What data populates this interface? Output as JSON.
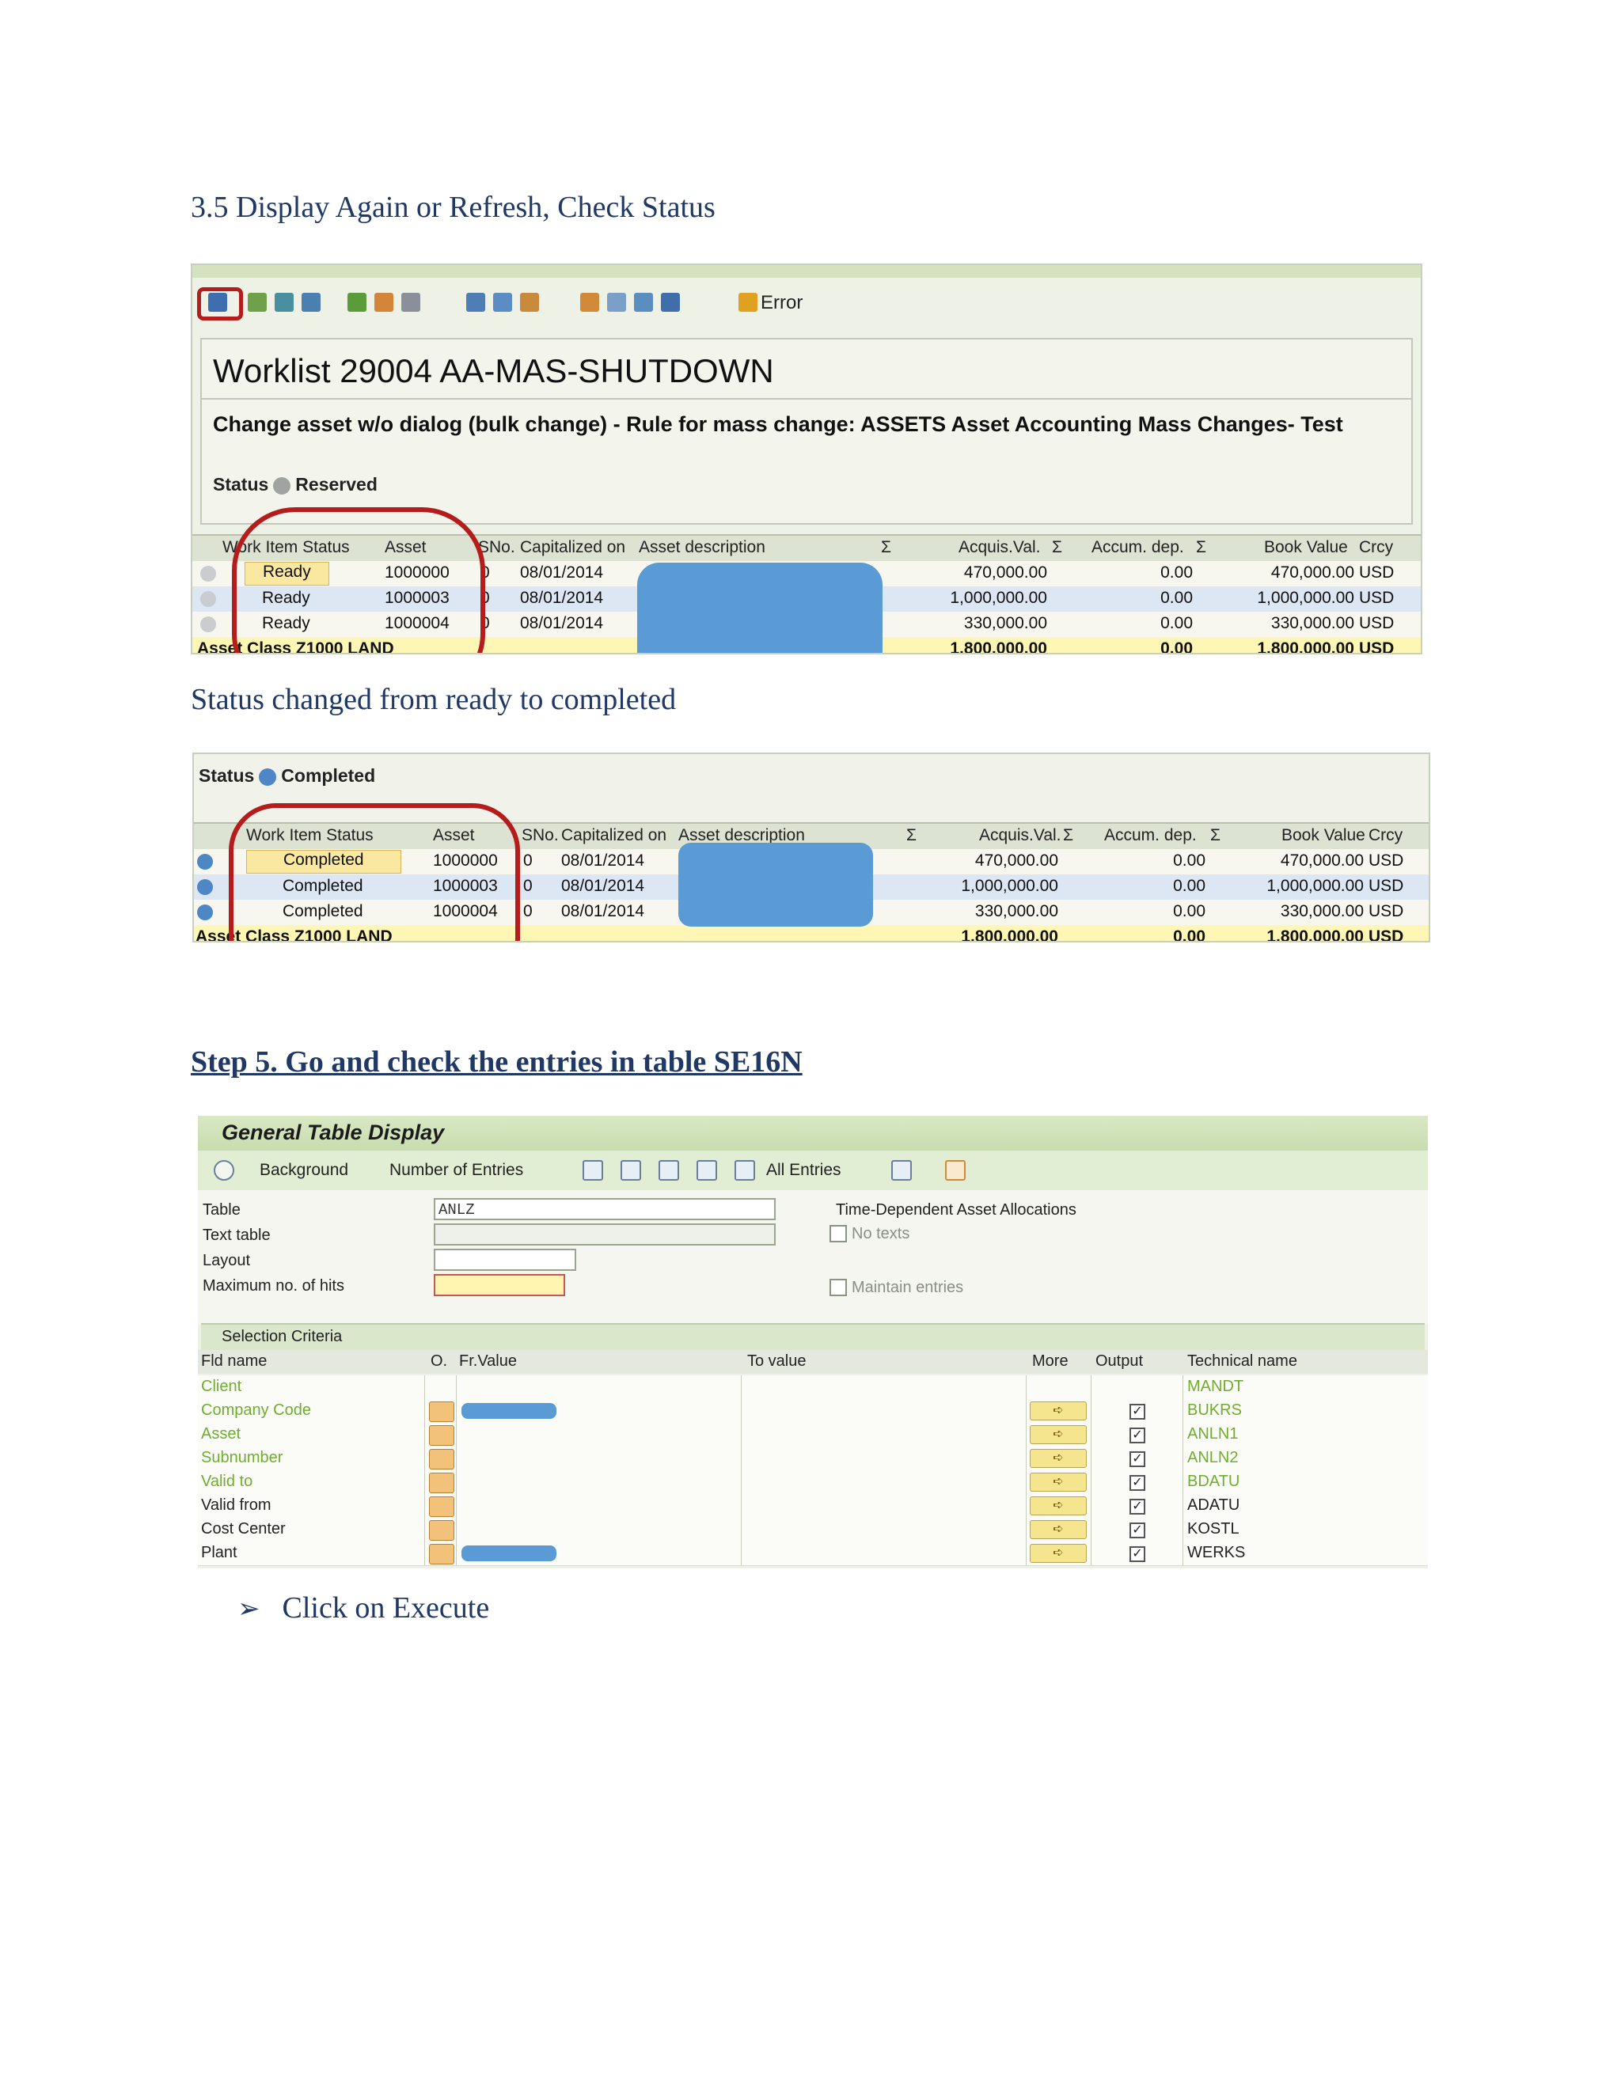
{
  "headings": {
    "section_35": "3.5 Display Again or Refresh, Check Status",
    "status_changed": "Status changed from ready to completed",
    "step5": "Step 5. Go and check the entries in table SE16N"
  },
  "bullet": {
    "text": "Click on Execute"
  },
  "worklist_screen": {
    "toolbar": {
      "error_label": "Error"
    },
    "title": "Worklist 29004 AA-MAS-SHUTDOWN",
    "subtitle": "Change asset w/o dialog (bulk change) - Rule for mass change: ASSETS Asset Accounting Mass Changes- Test",
    "status_label": "Status",
    "status_value": "Reserved",
    "columns": [
      "Work Item Status",
      "Asset",
      "SNo.",
      "Capitalized on",
      "Asset description",
      "Σ",
      "Acquis.Val.",
      "Σ",
      "Accum. dep.",
      "Σ",
      "Book Value",
      "Crcy"
    ],
    "rows": [
      {
        "status": "Ready",
        "asset": "1000000",
        "sno": "0",
        "cap": "08/01/2014",
        "acq": "470,000.00",
        "dep": "0.00",
        "book": "470,000.00",
        "crcy": "USD"
      },
      {
        "status": "Ready",
        "asset": "1000003",
        "sno": "0",
        "cap": "08/01/2014",
        "acq": "1,000,000.00",
        "dep": "0.00",
        "book": "1,000,000.00",
        "crcy": "USD"
      },
      {
        "status": "Ready",
        "asset": "1000004",
        "sno": "0",
        "cap": "08/01/2014",
        "acq": "330,000.00",
        "dep": "0.00",
        "book": "330,000.00",
        "crcy": "USD"
      }
    ],
    "total_row": {
      "label": "Asset Class Z1000 LAND",
      "acq": "1,800,000.00",
      "dep": "0.00",
      "book": "1,800,000.00",
      "crcy": "USD"
    }
  },
  "completed_screen": {
    "status_label": "Status",
    "status_value": "Completed",
    "columns": [
      "Work Item Status",
      "Asset",
      "SNo.",
      "Capitalized on",
      "Asset description",
      "Σ",
      "Acquis.Val.",
      "Σ",
      "Accum. dep.",
      "Σ",
      "Book Value",
      "Crcy"
    ],
    "rows": [
      {
        "status": "Completed",
        "asset": "1000000",
        "sno": "0",
        "cap": "08/01/2014",
        "acq": "470,000.00",
        "dep": "0.00",
        "book": "470,000.00",
        "crcy": "USD"
      },
      {
        "status": "Completed",
        "asset": "1000003",
        "sno": "0",
        "cap": "08/01/2014",
        "acq": "1,000,000.00",
        "dep": "0.00",
        "book": "1,000,000.00",
        "crcy": "USD"
      },
      {
        "status": "Completed",
        "asset": "1000004",
        "sno": "0",
        "cap": "08/01/2014",
        "acq": "330,000.00",
        "dep": "0.00",
        "book": "330,000.00",
        "crcy": "USD"
      }
    ],
    "total_row": {
      "label": "Asset Class Z1000 LAND",
      "acq": "1,800,000.00",
      "dep": "0.00",
      "book": "1,800,000.00",
      "crcy": "USD"
    }
  },
  "se16n_screen": {
    "title": "General Table Display",
    "toolbar": {
      "background": "Background",
      "number_of_entries": "Number of Entries",
      "all_entries": "All Entries"
    },
    "form": {
      "table_label": "Table",
      "table_value": "ANLZ",
      "text_table_label": "Text table",
      "layout_label": "Layout",
      "max_hits_label": "Maximum no. of hits",
      "max_hits_value": "",
      "table_desc": "Time-Dependent Asset Allocations",
      "no_texts": "No texts",
      "maintain_entries": "Maintain entries"
    },
    "selection_criteria": "Selection Criteria",
    "grid_columns": [
      "Fld name",
      "O.",
      "Fr.Value",
      "To value",
      "More",
      "Output",
      "Technical name"
    ],
    "fields": [
      {
        "name": "Client",
        "tech": "MANDT",
        "key": true,
        "has_controls": false,
        "filled": false
      },
      {
        "name": "Company Code",
        "tech": "BUKRS",
        "key": true,
        "has_controls": true,
        "filled": true
      },
      {
        "name": "Asset",
        "tech": "ANLN1",
        "key": true,
        "has_controls": true,
        "filled": false
      },
      {
        "name": "Subnumber",
        "tech": "ANLN2",
        "key": true,
        "has_controls": true,
        "filled": false
      },
      {
        "name": "Valid to",
        "tech": "BDATU",
        "key": true,
        "has_controls": true,
        "filled": false
      },
      {
        "name": "Valid from",
        "tech": "ADATU",
        "key": false,
        "has_controls": true,
        "filled": false
      },
      {
        "name": "Cost Center",
        "tech": "KOSTL",
        "key": false,
        "has_controls": true,
        "filled": false
      },
      {
        "name": "Plant",
        "tech": "WERKS",
        "key": false,
        "has_controls": true,
        "filled": true
      }
    ]
  },
  "colors": {
    "heading": "#1f3864",
    "highlight_red": "#b51d1d",
    "redaction_blue": "#5b9bd5",
    "key_field_green": "#6fae2e"
  }
}
